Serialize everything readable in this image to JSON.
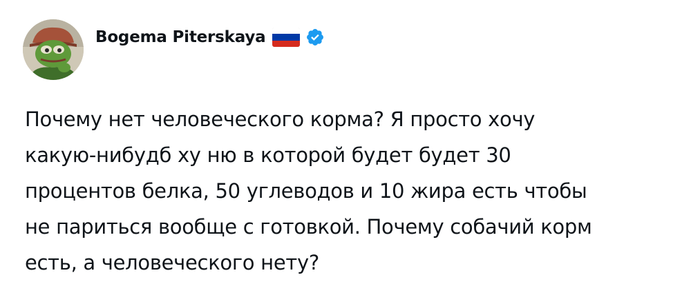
{
  "tweet": {
    "author": {
      "display_name": "Bogema Piterskaya",
      "avatar_icon": "pepe-frog-avatar",
      "flag_icon": "russia-flag-icon",
      "verified_icon": "verified-badge-icon"
    },
    "text_lines": [
      "Почему нет человеческого корма? Я просто хочу",
      "какую-нибудб ху ню в которой будет будет 30",
      "процентов белка, 50 углеводов и 10 жира есть чтобы",
      "не париться вообще с готовкой. Почему собачий корм",
      "есть, а человеческого нету?"
    ]
  },
  "colors": {
    "text": "#0f1419",
    "verified_blue": "#1d9bf0",
    "flag_white": "#ffffff",
    "flag_blue": "#0039a6",
    "flag_red": "#d52b1e"
  }
}
